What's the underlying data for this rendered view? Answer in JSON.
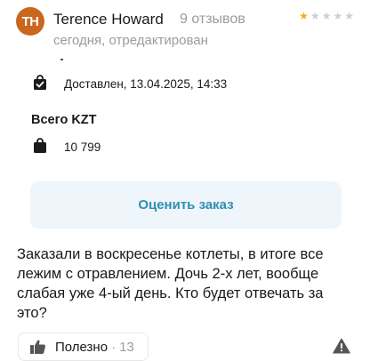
{
  "review": {
    "avatar_initials": "TH",
    "avatar_color": "#c9661f",
    "author": "Terence Howard",
    "reviews_count": "9 отзывов",
    "date": "сегодня, отредактирован",
    "rating": 1,
    "rating_max": 5,
    "text": "Заказали в воскресенье котлеты, в итоге все лежим с отравлением. Дочь 2-х лет, вообще слабая уже 4-ый день. Кто будет отвечать за это?"
  },
  "order": {
    "delivered_icon": "checked-bag-icon",
    "delivered": "Доставлен, 13.04.2025, 14:33",
    "total_title": "Всего KZT",
    "amount_icon": "shopping-bag-icon",
    "amount": "10 799"
  },
  "actions": {
    "rate_label": "Оценить заказ",
    "helpful_label": "Полезно",
    "helpful_separator": "·",
    "helpful_count": "13",
    "helpful_icon": "thumbs-up-icon",
    "report_icon": "warning-icon"
  },
  "colors": {
    "accent_text": "#2f8fb0",
    "button_bg": "#eef5fb",
    "star_on": "#f0b400",
    "star_off": "#cfcfcf",
    "muted": "#9b9b9b"
  }
}
